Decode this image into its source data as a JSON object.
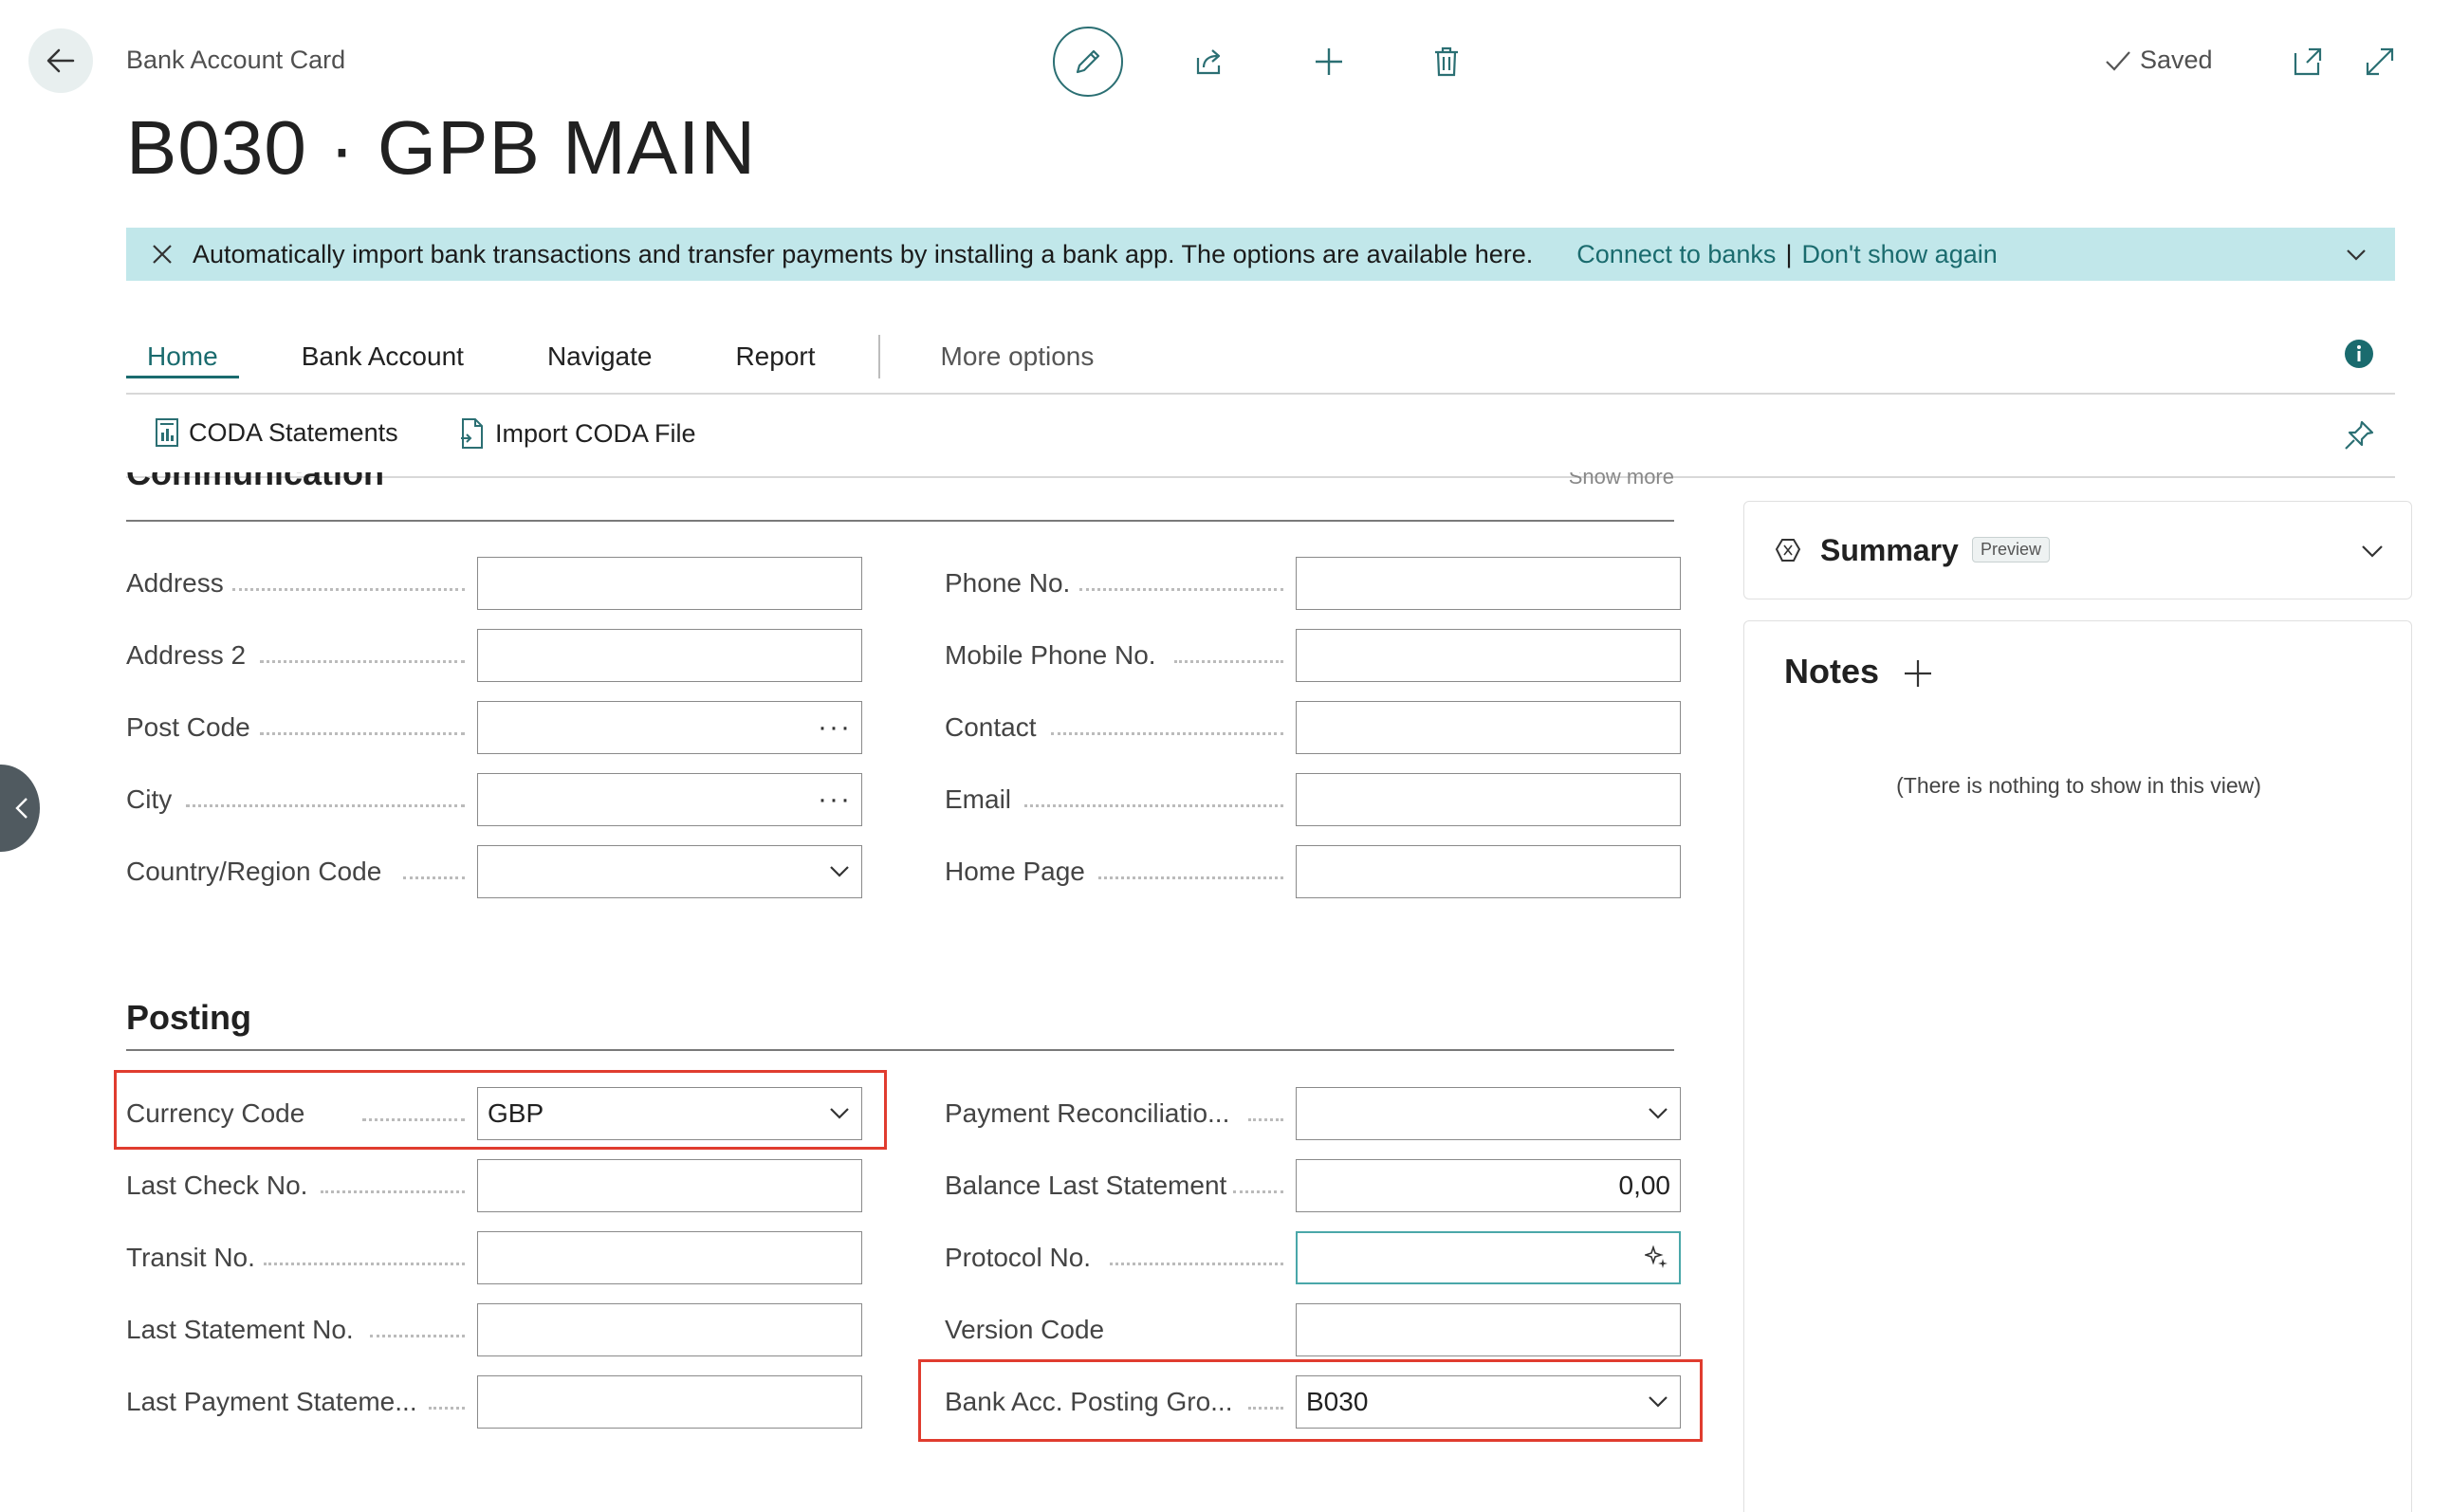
{
  "header": {
    "page_type": "Bank Account Card",
    "title": "B030 · GPB MAIN",
    "saved_label": "Saved"
  },
  "banner": {
    "message": "Automatically import bank transactions and transfer payments by installing a bank app. The options are available here.",
    "link_connect": "Connect to banks",
    "separator": "|",
    "link_dont_show": "Don't show again"
  },
  "tabs": [
    "Home",
    "Bank Account",
    "Navigate",
    "Report"
  ],
  "more_options": "More options",
  "actions": {
    "coda_statements": "CODA Statements",
    "import_coda": "Import CODA File"
  },
  "communication": {
    "title": "Communication",
    "show_more": "Show more",
    "left_fields": [
      {
        "label": "Address",
        "value": ""
      },
      {
        "label": "Address 2",
        "value": ""
      },
      {
        "label": "Post Code",
        "value": ""
      },
      {
        "label": "City",
        "value": ""
      },
      {
        "label": "Country/Region Code",
        "value": ""
      }
    ],
    "right_fields": [
      {
        "label": "Phone No.",
        "value": ""
      },
      {
        "label": "Mobile Phone No.",
        "value": ""
      },
      {
        "label": "Contact",
        "value": ""
      },
      {
        "label": "Email",
        "value": ""
      },
      {
        "label": "Home Page",
        "value": ""
      }
    ]
  },
  "posting": {
    "title": "Posting",
    "left_fields": [
      {
        "label": "Currency Code",
        "value": "GBP"
      },
      {
        "label": "Last Check No.",
        "value": ""
      },
      {
        "label": "Transit No.",
        "value": ""
      },
      {
        "label": "Last Statement No.",
        "value": ""
      },
      {
        "label": "Last Payment Stateme...",
        "value": ""
      }
    ],
    "right_fields": [
      {
        "label": "Payment Reconciliatio...",
        "value": ""
      },
      {
        "label": "Balance Last Statement",
        "value": "0,00"
      },
      {
        "label": "Protocol No.",
        "value": ""
      },
      {
        "label": "Version Code",
        "value": ""
      },
      {
        "label": "Bank Acc. Posting Gro...",
        "value": "B030"
      }
    ]
  },
  "side": {
    "summary_title": "Summary",
    "preview_badge": "Preview",
    "notes_title": "Notes",
    "notes_empty": "(There is nothing to show in this view)"
  },
  "colors": {
    "accent": "#1a6b6e",
    "banner_bg": "#c1e7ea",
    "highlight": "#e03c2f"
  }
}
